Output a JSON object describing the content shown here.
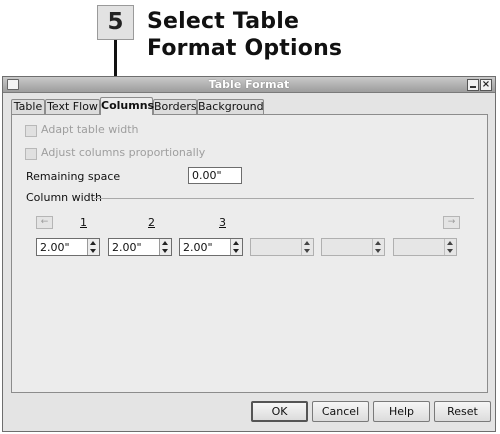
{
  "callout": {
    "step_number": "5",
    "title_line1": "Select Table",
    "title_line2": "Format Options"
  },
  "window": {
    "title": "Table Format",
    "icon": "window-icon",
    "min_icon": "minimize-icon",
    "close_icon": "close-icon",
    "close_glyph": "×"
  },
  "tabs": [
    {
      "label": "Table",
      "active": false
    },
    {
      "label": "Text Flow",
      "active": false
    },
    {
      "label": "Columns",
      "active": true
    },
    {
      "label": "Borders",
      "active": false
    },
    {
      "label": "Background",
      "active": false
    }
  ],
  "columns_tab": {
    "adapt_table_width": {
      "label": "Adapt table width",
      "checked": false,
      "disabled": true
    },
    "adjust_columns": {
      "label": "Adjust columns proportionally",
      "checked": false,
      "disabled": true
    },
    "remaining_space": {
      "label": "Remaining space",
      "value": "0.00\""
    },
    "column_width_group": "Column width",
    "left_arrow": "←",
    "right_arrow": "→",
    "column_numbers": [
      "1",
      "2",
      "3"
    ],
    "column_values": [
      "2.00\"",
      "2.00\"",
      "2.00\"",
      "",
      "",
      ""
    ]
  },
  "buttons": {
    "ok": "OK",
    "cancel": "Cancel",
    "help": "Help",
    "reset": "Reset"
  }
}
